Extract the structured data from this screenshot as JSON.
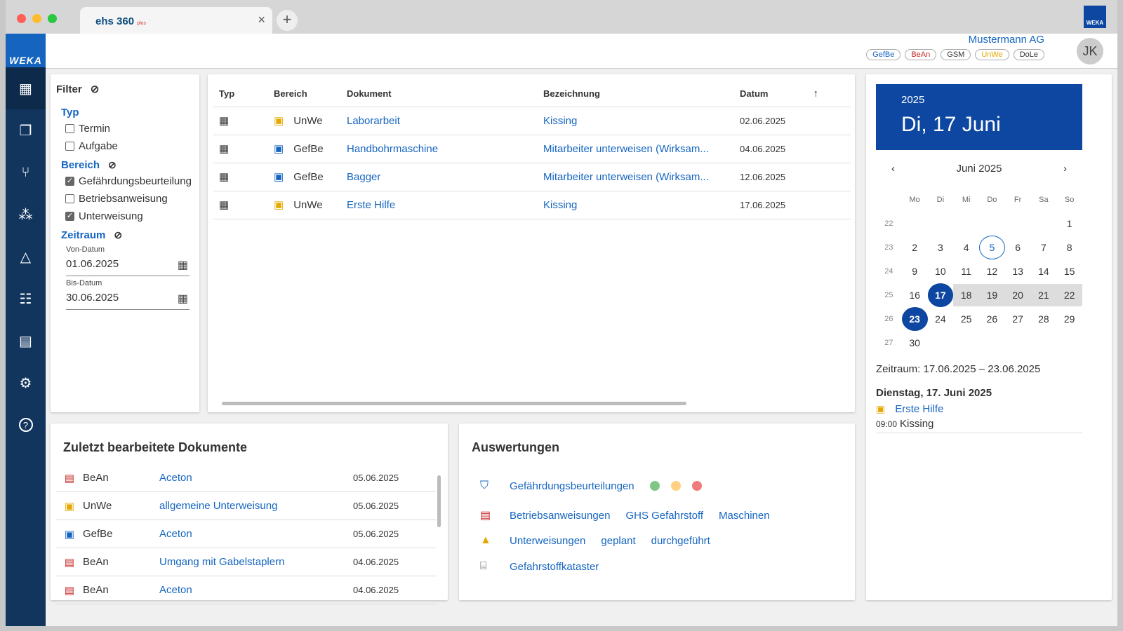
{
  "browser": {
    "tab_title": "ehs 360",
    "tab_suffix": "plus",
    "close": "×",
    "new_tab": "+",
    "brand_badge": "WEKA"
  },
  "sidebar": {
    "brand": "WEKA",
    "items": [
      {
        "icon": "dashboard-icon",
        "glyph": "▦"
      },
      {
        "icon": "folders-icon",
        "glyph": "❐"
      },
      {
        "icon": "fork-icon",
        "glyph": "⑂"
      },
      {
        "icon": "nodes-icon",
        "glyph": "⁂"
      },
      {
        "icon": "shapes-icon",
        "glyph": "△"
      },
      {
        "icon": "group-icon",
        "glyph": "☷"
      },
      {
        "icon": "table-icon",
        "glyph": "▤"
      },
      {
        "icon": "gear-icon",
        "glyph": "⚙"
      },
      {
        "icon": "help-icon",
        "glyph": "?"
      }
    ]
  },
  "header": {
    "company": "Mustermann AG",
    "avatar": "JK",
    "tags": [
      {
        "label": "GefBe",
        "color": "#1565c0"
      },
      {
        "label": "BeAn",
        "color": "#c62828"
      },
      {
        "label": "GSM",
        "color": "#333333"
      },
      {
        "label": "UnWe",
        "color": "#e6a800"
      },
      {
        "label": "DoLe",
        "color": "#333333"
      }
    ]
  },
  "filter": {
    "title": "Filter",
    "typ": {
      "heading": "Typ",
      "options": [
        {
          "label": "Termin",
          "checked": false
        },
        {
          "label": "Aufgabe",
          "checked": false
        }
      ]
    },
    "bereich": {
      "heading": "Bereich",
      "options": [
        {
          "label": "Gefährdungsbeurteilung",
          "checked": true
        },
        {
          "label": "Betriebsanweisung",
          "checked": false
        },
        {
          "label": "Unterweisung",
          "checked": true
        }
      ]
    },
    "zeitraum": {
      "heading": "Zeitraum",
      "from_label": "Von-Datum",
      "from_value": "01.06.2025",
      "to_label": "Bis-Datum",
      "to_value": "30.06.2025"
    }
  },
  "table": {
    "headers": {
      "typ": "Typ",
      "bereich": "Bereich",
      "dokument": "Dokument",
      "bezeichnung": "Bezeichnung",
      "datum": "Datum",
      "sort": "↑"
    },
    "rows": [
      {
        "bereich": "UnWe",
        "dokument": "Laborarbeit",
        "bezeichnung": "Kissing",
        "datum": "02.06.2025"
      },
      {
        "bereich": "GefBe",
        "dokument": "Handbohrmaschine",
        "bezeichnung": "Mitarbeiter unterweisen (Wirksam...",
        "datum": "04.06.2025"
      },
      {
        "bereich": "GefBe",
        "dokument": "Bagger",
        "bezeichnung": "Mitarbeiter unterweisen (Wirksam...",
        "datum": "12.06.2025"
      },
      {
        "bereich": "UnWe",
        "dokument": "Erste Hilfe",
        "bezeichnung": "Kissing",
        "datum": "17.06.2025"
      }
    ]
  },
  "recent": {
    "title": "Zuletzt bearbeitete Dokumente",
    "items": [
      {
        "bereich": "BeAn",
        "name": "Aceton",
        "date": "05.06.2025"
      },
      {
        "bereich": "UnWe",
        "name": "allgemeine Unterweisung",
        "date": "05.06.2025"
      },
      {
        "bereich": "GefBe",
        "name": "Aceton",
        "date": "05.06.2025"
      },
      {
        "bereich": "BeAn",
        "name": "Umgang mit Gabelstaplern",
        "date": "04.06.2025"
      },
      {
        "bereich": "BeAn",
        "name": "Aceton",
        "date": "04.06.2025"
      }
    ]
  },
  "auswertungen": {
    "title": "Auswertungen",
    "gefbe": "Gefährdungsbeurteilungen",
    "status_colors": [
      "#81c784",
      "#ffd180",
      "#ef7b7b"
    ],
    "bean": "Betriebsanweisungen",
    "bean_ghs": "GHS Gefahrstoff",
    "bean_masch": "Maschinen",
    "unwe": "Unterweisungen",
    "unwe_geplant": "geplant",
    "unwe_durch": "durchgeführt",
    "kataster": "Gefahrstoffkataster"
  },
  "calendar": {
    "year": "2025",
    "date": "Di, 17 Juni",
    "month": "Juni 2025",
    "prev": "‹",
    "next": "›",
    "weekdays": [
      "Mo",
      "Di",
      "Mi",
      "Do",
      "Fr",
      "Sa",
      "So"
    ],
    "weeks": [
      {
        "wk": "22",
        "days": [
          "",
          "",
          "",
          "",
          "",
          "",
          "1"
        ]
      },
      {
        "wk": "23",
        "days": [
          "2",
          "3",
          "4",
          "5",
          "6",
          "7",
          "8"
        ]
      },
      {
        "wk": "24",
        "days": [
          "9",
          "10",
          "11",
          "12",
          "13",
          "14",
          "15"
        ]
      },
      {
        "wk": "25",
        "days": [
          "16",
          "17",
          "18",
          "19",
          "20",
          "21",
          "22"
        ]
      },
      {
        "wk": "26",
        "days": [
          "23",
          "24",
          "25",
          "26",
          "27",
          "28",
          "29"
        ]
      },
      {
        "wk": "27",
        "days": [
          "30",
          "",
          "",
          "",
          "",
          "",
          ""
        ]
      }
    ],
    "zeitraum": "Zeitraum: 17.06.2025 – 23.06.2025",
    "event_day": "Dienstag, 17. Juni 2025",
    "event_name": "Erste Hilfe",
    "event_time": "09:00",
    "event_loc": "Kissing"
  }
}
